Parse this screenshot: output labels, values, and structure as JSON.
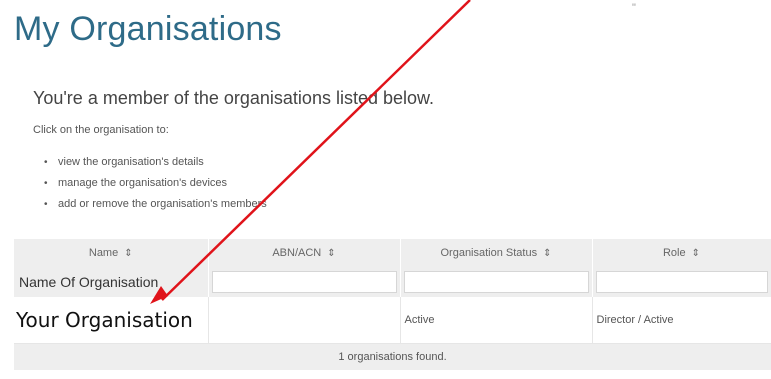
{
  "page": {
    "title": "My Organisations",
    "corner_mark": "\"",
    "intro": "You're a member of the organisations listed below.",
    "click_on": "Click on the organisation to:",
    "bullets": [
      "view the organisation's details",
      "manage the organisation's devices",
      "add or remove the organisation's members"
    ]
  },
  "table": {
    "headers": {
      "name": "Name",
      "abn": "ABN/ACN",
      "status": "Organisation Status",
      "role": "Role"
    },
    "sort_glyph": "⇕",
    "filters": {
      "name_value": "Name Of Organisation",
      "abn_value": "",
      "status_value": "",
      "role_value": ""
    },
    "rows": [
      {
        "name": "Your Organisation",
        "abn": "",
        "status": "Active",
        "role": "Director / Active"
      }
    ],
    "footer": "1 organisations found."
  },
  "annotation": {
    "arrow_color": "#e0131a"
  },
  "colors": {
    "title": "#2e6b88",
    "header_bg": "#eeeeee"
  }
}
